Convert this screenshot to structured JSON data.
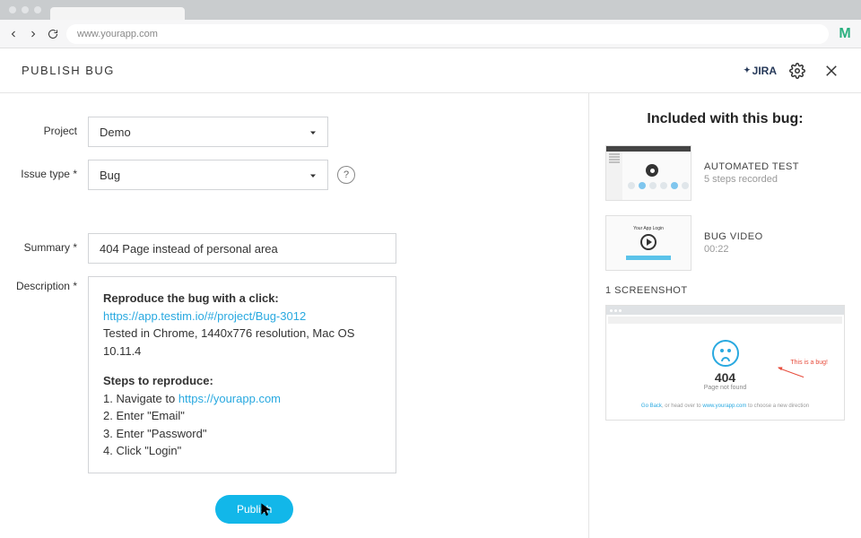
{
  "browser": {
    "url": "www.yourapp.com",
    "brand_glyph": "M"
  },
  "header": {
    "title": "PUBLISH BUG",
    "integration": "JIRA"
  },
  "form": {
    "project": {
      "label": "Project",
      "value": "Demo"
    },
    "issue_type": {
      "label": "Issue type",
      "value": "Bug"
    },
    "summary": {
      "label": "Summary",
      "value": "404 Page instead of personal area"
    },
    "description": {
      "label": "Description",
      "intro_bold": "Reproduce the bug with a click:",
      "link": "https://app.testim.io/#/project/Bug-3012",
      "env_line": "Tested in Chrome, 1440x776 resolution, Mac OS 10.11.4",
      "steps_header": "Steps to reproduce:",
      "steps": [
        "1. Navigate to https://yourapp.com",
        "2. Enter \"Email\"",
        "3. Enter \"Password\"",
        "4. Click \"Login\""
      ],
      "step_link_text": "https://yourapp.com"
    },
    "publish_label": "Publish"
  },
  "sidebar": {
    "title": "Included with this bug:",
    "attachments": [
      {
        "title": "AUTOMATED TEST",
        "sub": "5 steps recorded"
      },
      {
        "title": "BUG VIDEO",
        "sub": "00:22"
      }
    ],
    "screenshot_header": "1 SCREENSHOT",
    "screenshot": {
      "code": "404",
      "msg": "Page not found",
      "callout": "This is a bug!",
      "footer_prefix": "Go Back",
      "footer_mid": ", or head over to ",
      "footer_link": "www.yourapp.com",
      "footer_suffix": " to choose a new direction"
    }
  },
  "colors": {
    "accent": "#12b7e9",
    "link": "#29a9e0"
  }
}
